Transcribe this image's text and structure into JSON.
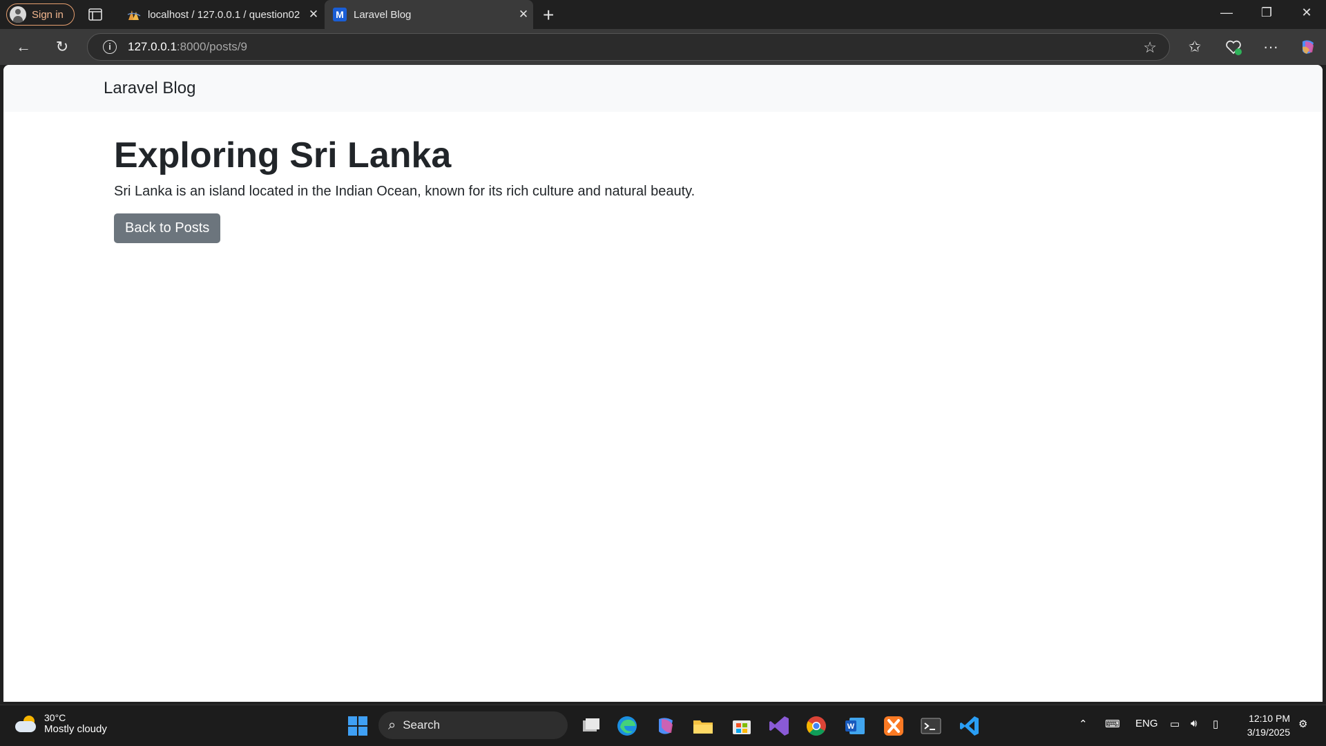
{
  "browser": {
    "signin_label": "Sign in",
    "tabs": [
      {
        "title": "localhost / 127.0.0.1 / question02",
        "icon": "phpmyadmin-icon"
      },
      {
        "title": "Laravel Blog",
        "icon": "m-favicon-icon"
      }
    ],
    "address": {
      "host": "127.0.0.1",
      "path": ":8000/posts/9"
    }
  },
  "page": {
    "brand": "Laravel Blog",
    "post": {
      "title": "Exploring Sri Lanka",
      "body": "Sri Lanka is an island located in the Indian Ocean, known for its rich culture and natural beauty."
    },
    "back_button": "Back to Posts"
  },
  "taskbar": {
    "weather": {
      "temp": "30°C",
      "condition": "Mostly cloudy"
    },
    "search_label": "Search",
    "language": "ENG",
    "time": "12:10 PM",
    "date": "3/19/2025"
  },
  "colors": {
    "button_bg": "#6c757d",
    "navbar_bg": "#f8f9fa",
    "signin_accent": "#e8a070"
  }
}
